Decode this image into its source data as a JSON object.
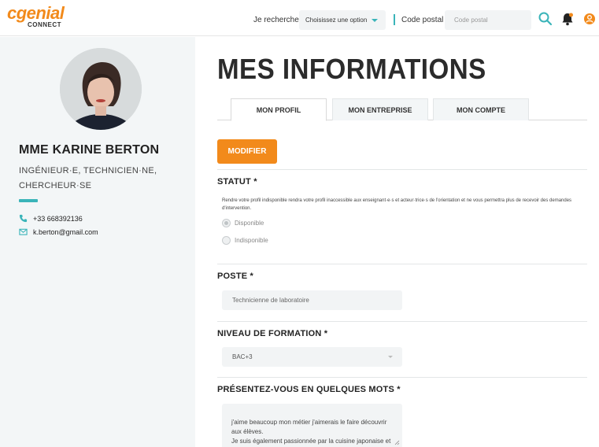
{
  "header": {
    "logo_main": "cgenial",
    "logo_sub": "CONNECT",
    "search_label": "Je recherche",
    "search_select_value": "Choisissez une option",
    "postal_label": "Code postal",
    "postal_placeholder": "Code postal",
    "icons": [
      "search-icon",
      "bell-icon",
      "user-icon"
    ]
  },
  "profile": {
    "name": "MME KARINE BERTON",
    "role": "INGÉNIEUR·E, TECHNICIEN·NE, CHERCHEUR·SE",
    "phone": "+33 668392136",
    "email": "k.berton@gmail.com"
  },
  "main": {
    "title": "MES INFORMATIONS",
    "tabs": [
      {
        "label": "MON PROFIL",
        "active": true
      },
      {
        "label": "MON ENTREPRISE",
        "active": false
      },
      {
        "label": "MON COMPTE",
        "active": false
      }
    ],
    "modify_label": "MODIFIER",
    "statut": {
      "title": "STATUT *",
      "description": "Rendre votre profil indisponible rendra votre profil inaccessible aux enseignant·e·s et acteur·trice·s de l'orientation et ne vous permettra plus de recevoir des demandes d'intervention.",
      "options": [
        "Disponible",
        "Indisponible"
      ],
      "selected": "Disponible"
    },
    "poste": {
      "title": "POSTE *",
      "value": "Technicienne de laboratoire"
    },
    "niveau": {
      "title": "NIVEAU DE FORMATION *",
      "value": "BAC+3"
    },
    "presentation": {
      "title": "PRÉSENTEZ-VOUS EN QUELQUES MOTS *",
      "value": "j'aime beaucoup mon métier j'aimerais le faire découvrir aux élèves.\nJe suis également passionnée par la cuisine japonaise et la plongée sous-marine."
    }
  },
  "colors": {
    "brand_orange": "#f28a1b",
    "accent_teal": "#3ab4b9",
    "sidebar_bg": "#f3f6f7"
  }
}
